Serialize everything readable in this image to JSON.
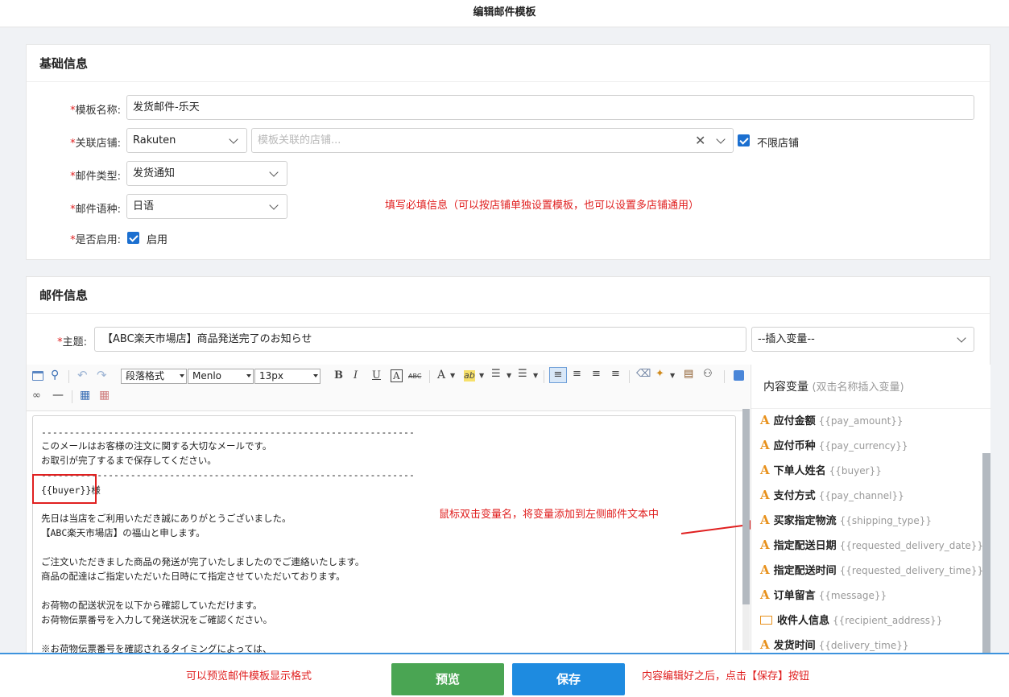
{
  "page": {
    "title": "编辑邮件模板"
  },
  "basic": {
    "heading": "基础信息",
    "name_label": "模板名称:",
    "name_value": "发货邮件-乐天",
    "shop_label": "关联店铺:",
    "shop_platform": "Rakuten",
    "shop_placeholder": "模板关联的店铺...",
    "unlimited_label": "不限店铺",
    "type_label": "邮件类型:",
    "type_value": "发货通知",
    "lang_label": "邮件语种:",
    "lang_value": "日语",
    "enabled_label": "是否启用:",
    "enabled_text": "启用",
    "note": "填写必填信息（可以按店铺单独设置模板，也可以设置多店铺通用）"
  },
  "mail": {
    "heading": "邮件信息",
    "subject_label": "主题:",
    "subject_value": "【ABC楽天市場店】商品発送完了のお知らせ",
    "insert_var": "--插入变量--"
  },
  "toolbar": {
    "paragraph": "段落格式",
    "font": "Menlo",
    "size": "13px",
    "bold": "B",
    "italic": "I",
    "underline": "U",
    "boxed_a": "A",
    "strike": "ABC",
    "font_color": "A",
    "highlight": "ab"
  },
  "editor": {
    "lines": [
      "-------------------------------------------------------------------",
      "このメールはお客様の注文に関する大切なメールです。",
      "お取引が完了するまで保存してください。",
      "-------------------------------------------------------------------",
      "{{buyer}}様",
      "先日は当店をご利用いただき誠にありがとうございました。",
      "【ABC楽天市場店】の福山と申します。",
      "ご注文いただきました商品の発送が完了いたしましたのでご連絡いたします。",
      "商品の配達はご指定いただいた日時にて指定させていただいております。",
      "お荷物の配送状況を以下から確認していただけます。",
      "お荷物伝票番号を入力して発送状況をご確認ください。",
      "※お荷物伝票番号を確認されるタイミングによっては、"
    ],
    "annotation": "鼠标双击变量名，将变量添加到左侧邮件文本中"
  },
  "variables": {
    "heading": "内容变量",
    "hint": "(双击名称插入变量)",
    "items": [
      {
        "name": "应付金额",
        "key": "{{pay_amount}}"
      },
      {
        "name": "应付币种",
        "key": "{{pay_currency}}"
      },
      {
        "name": "下单人姓名",
        "key": "{{buyer}}"
      },
      {
        "name": "支付方式",
        "key": "{{pay_channel}}"
      },
      {
        "name": "买家指定物流",
        "key": "{{shipping_type}}"
      },
      {
        "name": "指定配送日期",
        "key": "{{requested_delivery_date}}"
      },
      {
        "name": "指定配送时间",
        "key": "{{requested_delivery_time}}"
      },
      {
        "name": "订单留言",
        "key": "{{message}}"
      },
      {
        "name": "收件人信息",
        "key": "{{recipient_address}}"
      },
      {
        "name": "发货时间",
        "key": "{{delivery_time}}"
      }
    ]
  },
  "footer": {
    "preview_note": "可以预览邮件模板显示格式",
    "preview_button": "预览",
    "save_button": "保存",
    "save_note": "内容编辑好之后，点击【保存】按钮"
  },
  "colors": {
    "preview_green": "#4aa553",
    "save_blue": "#1e8be0",
    "annotation_red": "#e02020"
  }
}
